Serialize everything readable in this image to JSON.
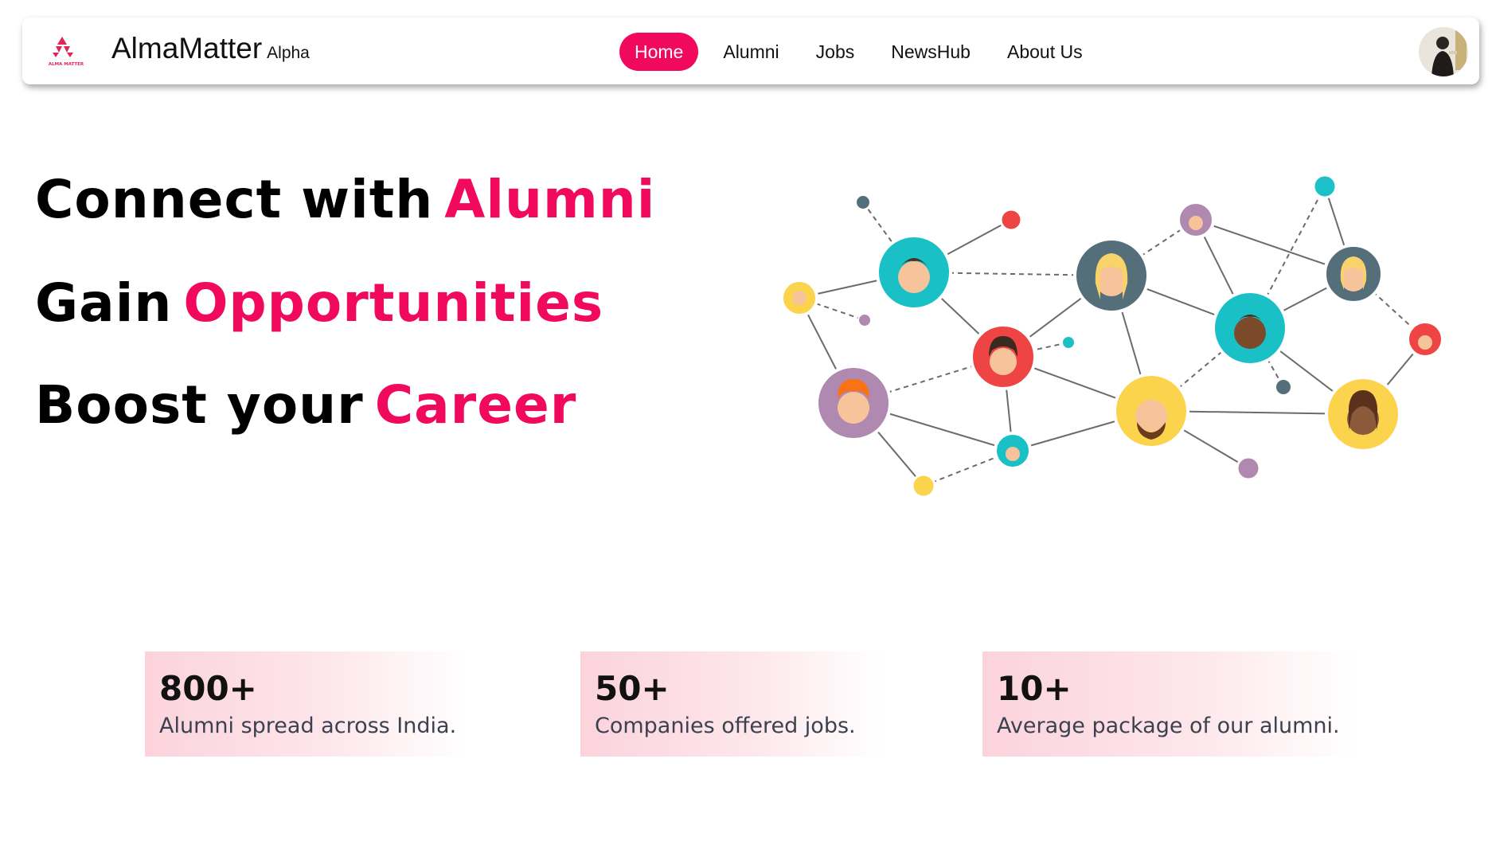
{
  "navbar": {
    "logo_text": "ALMA MATTER",
    "brand_name": "AlmaMatter",
    "brand_tag": "Alpha",
    "links": [
      {
        "label": "Home",
        "active": true
      },
      {
        "label": "Alumni",
        "active": false
      },
      {
        "label": "Jobs",
        "active": false
      },
      {
        "label": "NewsHub",
        "active": false
      },
      {
        "label": "About Us",
        "active": false
      }
    ]
  },
  "hero": {
    "lines": [
      {
        "plain": "Connect with",
        "accent": "Alumni"
      },
      {
        "plain": "Gain",
        "accent": "Opportunities"
      },
      {
        "plain": "Boost your",
        "accent": "Career"
      }
    ]
  },
  "stats": [
    {
      "value": "800+",
      "label": "Alumni spread across India."
    },
    {
      "value": "50+",
      "label": "Companies offered jobs."
    },
    {
      "value": "10+",
      "label": "Average package of our alumni."
    }
  ],
  "colors": {
    "accent": "#f1095d",
    "stat_bg": "#fcd3dc"
  }
}
